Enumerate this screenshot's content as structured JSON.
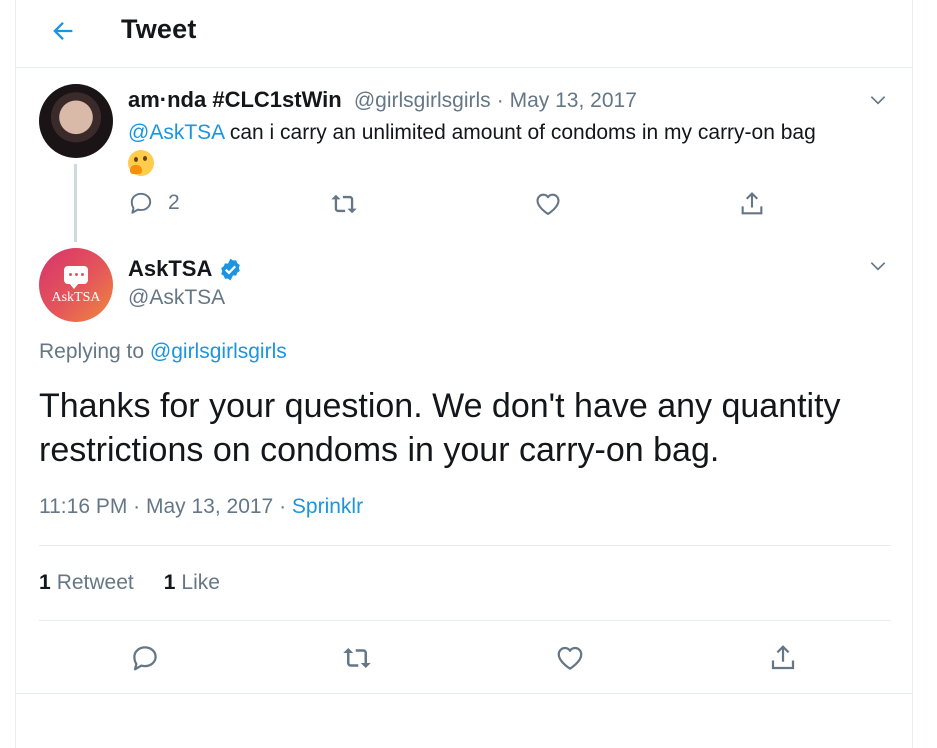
{
  "header": {
    "title": "Tweet"
  },
  "parent_tweet": {
    "display_name": "am·nda #CLC1stWin",
    "handle": "@girlsgirlsgirls",
    "date": "May 13, 2017",
    "mention": "@AskTSA",
    "text": " can i carry an unlimited amount of condoms in my carry-on bag",
    "emoji": "thinking-face",
    "reply_count": "2"
  },
  "main_tweet": {
    "display_name": "AskTSA",
    "handle": "@AskTSA",
    "avatar_label": "AskTSA",
    "replying_prefix": "Replying to ",
    "replying_to": "@girlsgirlsgirls",
    "text": "Thanks for your question. We don't have any quantity restrictions on condoms in your carry-on bag.",
    "time": "11:16 PM · May 13, 2017 · ",
    "source": "Sprinklr",
    "retweet_count": "1",
    "retweet_label": "Retweet",
    "like_count": "1",
    "like_label": "Like"
  },
  "colors": {
    "accent": "#1b95e0",
    "muted": "#657786",
    "text": "#14171a",
    "border": "#e6ecf0"
  }
}
